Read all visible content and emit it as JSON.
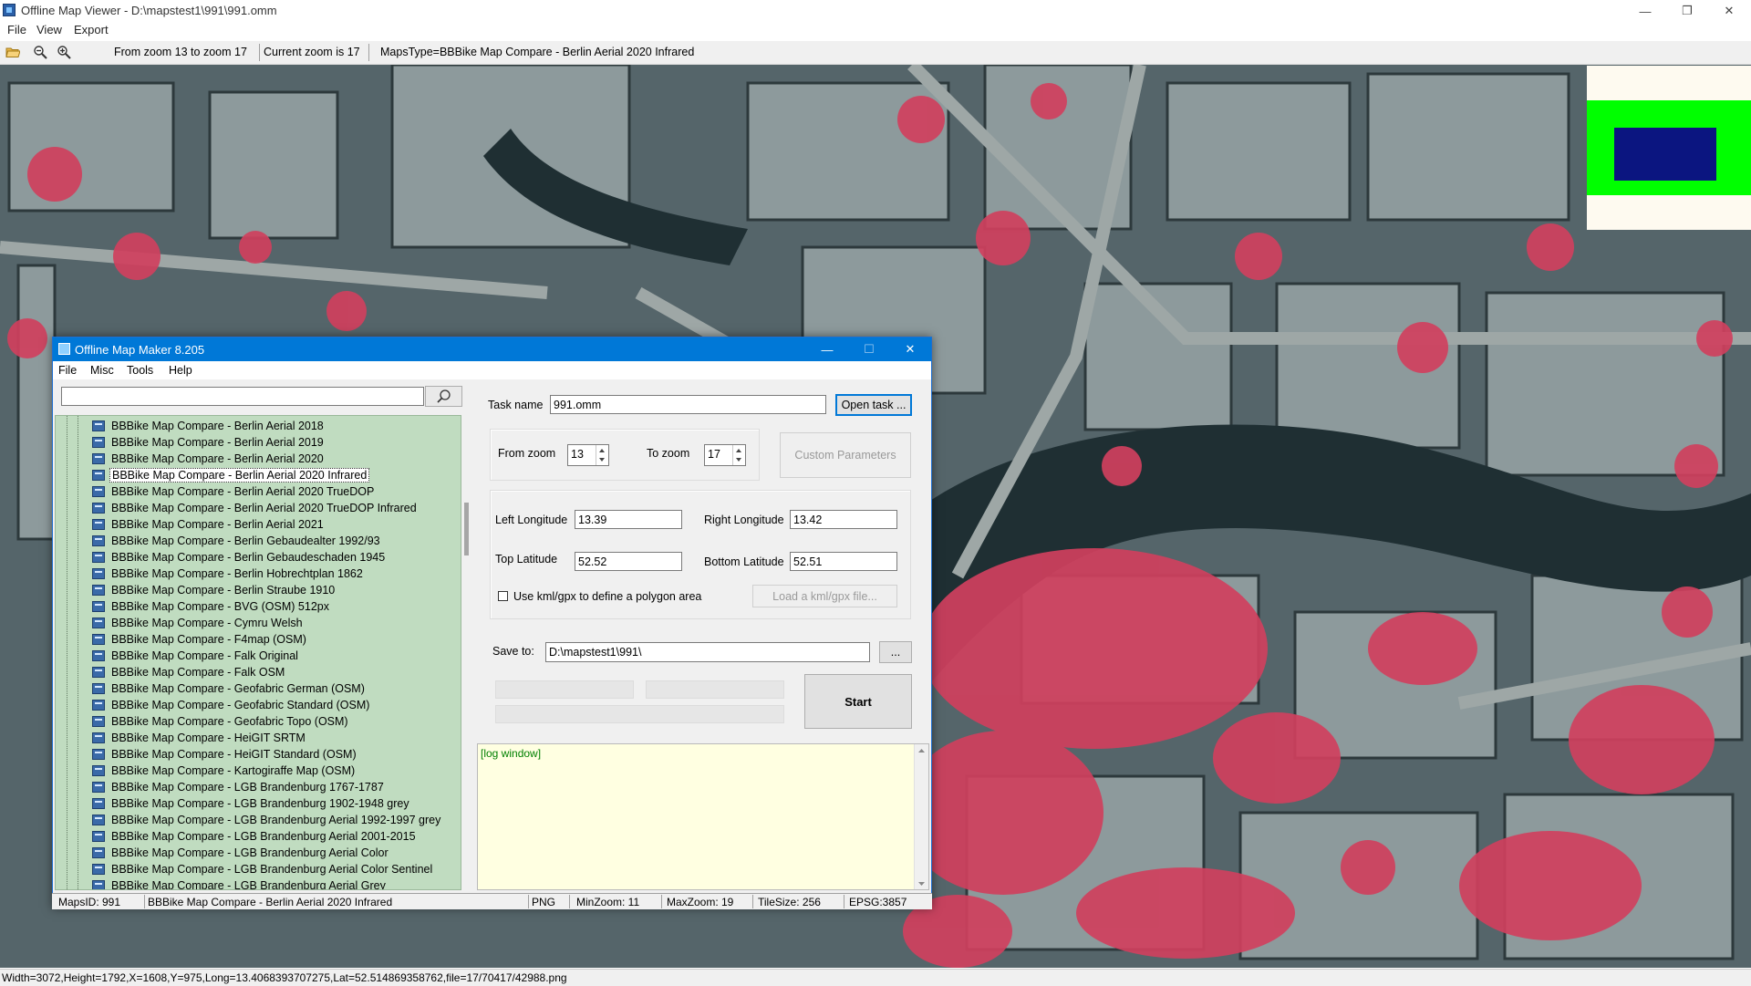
{
  "viewer": {
    "title": "Offline Map Viewer - D:\\mapstest1\\991\\991.omm",
    "menu": [
      "File",
      "View",
      "Export"
    ],
    "toolbar": {
      "zoom_range": "From zoom 13 to zoom 17",
      "current_zoom": "Current zoom is 17",
      "maps_type": "MapsType=BBBike Map Compare - Berlin Aerial 2020 Infrared"
    },
    "window_buttons": {
      "minimize": "—",
      "restore": "❐",
      "close": "✕"
    },
    "status": "Width=3072,Height=1792,X=1608,Y=975,Long=13.4068393707275,Lat=52.514869358762,file=17/70417/42988.png"
  },
  "dialog": {
    "title": "Offline Map Maker 8.205",
    "menu": [
      "File",
      "Misc",
      "Tools",
      "Help"
    ],
    "window_buttons": {
      "minimize": "—",
      "maximize": "☐",
      "close": "✕"
    },
    "search": {
      "value": "",
      "icon": "search-icon"
    },
    "tree_items": [
      "BBBike Map Compare - Berlin Aerial 2018",
      "BBBike Map Compare - Berlin Aerial 2019",
      "BBBike Map Compare - Berlin Aerial 2020",
      "BBBike Map Compare - Berlin Aerial 2020 Infrared",
      "BBBike Map Compare - Berlin Aerial 2020 TrueDOP",
      "BBBike Map Compare - Berlin Aerial 2020 TrueDOP Infrared",
      "BBBike Map Compare - Berlin Aerial 2021",
      "BBBike Map Compare - Berlin Gebaudealter 1992/93",
      "BBBike Map Compare - Berlin Gebaudeschaden 1945",
      "BBBike Map Compare - Berlin Hobrechtplan 1862",
      "BBBike Map Compare - Berlin Straube 1910",
      "BBBike Map Compare - BVG (OSM) 512px",
      "BBBike Map Compare - Cymru Welsh",
      "BBBike Map Compare - F4map (OSM)",
      "BBBike Map Compare - Falk Original",
      "BBBike Map Compare - Falk OSM",
      "BBBike Map Compare - Geofabric German (OSM)",
      "BBBike Map Compare - Geofabric Standard (OSM)",
      "BBBike Map Compare - Geofabric Topo (OSM)",
      "BBBike Map Compare - HeiGIT SRTM",
      "BBBike Map Compare - HeiGIT Standard (OSM)",
      "BBBike Map Compare - Kartogiraffe Map (OSM)",
      "BBBike Map Compare - LGB Brandenburg 1767-1787",
      "BBBike Map Compare - LGB Brandenburg 1902-1948 grey",
      "BBBike Map Compare - LGB Brandenburg Aerial 1992-1997 grey",
      "BBBike Map Compare - LGB Brandenburg Aerial 2001-2015",
      "BBBike Map Compare - LGB Brandenburg Aerial Color",
      "BBBike Map Compare - LGB Brandenburg Aerial Color Sentinel",
      "BBBike Map Compare - LGB Brandenburg Aerial Grey"
    ],
    "selected_item": "BBBike Map Compare - Berlin Aerial 2020 Infrared",
    "task": {
      "label": "Task name",
      "value": "991.omm",
      "open_button": "Open task ..."
    },
    "zoom": {
      "from_label": "From zoom",
      "from_value": "13",
      "to_label": "To zoom",
      "to_value": "17",
      "custom_button": "Custom Parameters"
    },
    "coords": {
      "left_label": "Left Longitude",
      "left_value": "13.39",
      "right_label": "Right Longitude",
      "right_value": "13.42",
      "top_label": "Top Latitude",
      "top_value": "52.52",
      "bottom_label": "Bottom Latitude",
      "bottom_value": "52.51",
      "kml_label": "Use kml/gpx to define a polygon area",
      "kml_button": "Load a kml/gpx file..."
    },
    "save": {
      "label": "Save to:",
      "value": "D:\\mapstest1\\991\\",
      "browse_button": "..."
    },
    "start_button": "Start",
    "log": "[log window]",
    "status": {
      "maps_id": "MapsID: 991",
      "name": "BBBike Map Compare - Berlin Aerial 2020 Infrared",
      "format": "PNG",
      "min_zoom": "MinZoom: 11",
      "max_zoom": "MaxZoom: 19",
      "tile_size": "TileSize: 256",
      "epsg": "EPSG:3857"
    }
  },
  "colors": {
    "accent": "#0078d7",
    "tree_bg": "#c0dcc0",
    "log_bg": "#ffffe1",
    "map_vegetation": "#d0405e",
    "minimap_green": "#00ff00",
    "minimap_blue": "#0b1580"
  }
}
